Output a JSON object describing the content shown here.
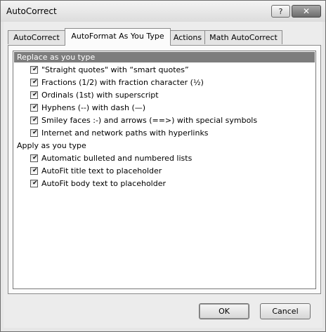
{
  "window": {
    "title": "AutoCorrect",
    "help_glyph": "?",
    "close_glyph": "✕"
  },
  "tabs": [
    {
      "label": "AutoCorrect",
      "active": false
    },
    {
      "label": "AutoFormat As You Type",
      "active": true
    },
    {
      "label": "Actions",
      "active": false
    },
    {
      "label": "Math AutoCorrect",
      "active": false
    }
  ],
  "groups": [
    {
      "label": "Replace as you type",
      "selected": true,
      "items": [
        {
          "label": "\"Straight quotes\" with “smart quotes”",
          "checked": true
        },
        {
          "label": "Fractions (1/2) with fraction character (½)",
          "checked": true
        },
        {
          "label": "Ordinals (1st) with superscript",
          "checked": true
        },
        {
          "label": "Hyphens (--) with dash (—)",
          "checked": true
        },
        {
          "label": "Smiley faces :-) and arrows (==>) with special symbols",
          "checked": true
        },
        {
          "label": "Internet and network paths with hyperlinks",
          "checked": true
        }
      ]
    },
    {
      "label": "Apply as you type",
      "selected": false,
      "items": [
        {
          "label": "Automatic bulleted and numbered lists",
          "checked": true
        },
        {
          "label": "AutoFit title text to placeholder",
          "checked": true
        },
        {
          "label": "AutoFit body text to placeholder",
          "checked": true
        }
      ]
    }
  ],
  "check_glyph": "✔",
  "buttons": {
    "ok": "OK",
    "cancel": "Cancel"
  }
}
